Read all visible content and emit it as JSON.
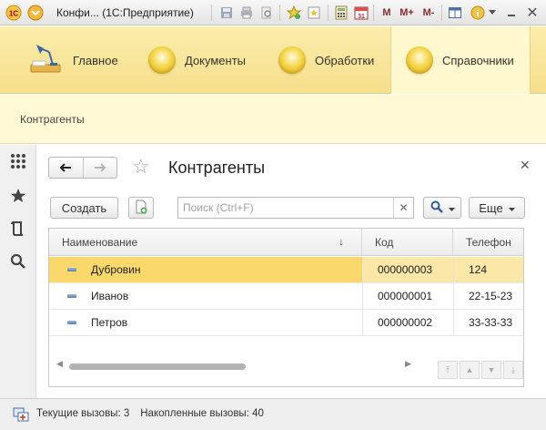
{
  "titlebar": {
    "title": "Конфи... (1С:Предприятие)",
    "m_label": "M",
    "m_plus_label": "M+",
    "m_minus_label": "M-"
  },
  "sections": [
    {
      "label": "Главное",
      "icon": "desk-lamp-icon"
    },
    {
      "label": "Документы",
      "icon": "orb-icon"
    },
    {
      "label": "Обработки",
      "icon": "orb-icon"
    },
    {
      "label": "Справочники",
      "icon": "orb-icon",
      "active": true
    }
  ],
  "section_bar": {
    "crumb": "Контрагенты"
  },
  "form": {
    "title": "Контрагенты",
    "create_label": "Создать",
    "search_placeholder": "Поиск (Ctrl+F)",
    "more_label": "Еще"
  },
  "table": {
    "columns": [
      "Наименование",
      "Код",
      "Телефон"
    ],
    "rows": [
      {
        "name": "Дубровин",
        "code": "000000003",
        "phone": "124",
        "selected": true
      },
      {
        "name": "Иванов",
        "code": "000000001",
        "phone": "22-15-23"
      },
      {
        "name": "Петров",
        "code": "000000002",
        "phone": "33-33-33"
      }
    ]
  },
  "status": {
    "current_calls": "Текущие вызовы: 3",
    "accumulated_calls": "Накопленные вызовы: 40"
  },
  "colors": {
    "section_panel": "#f6df8d",
    "selected_row": "#fbd86c",
    "accent_text": "#8a2b2b"
  }
}
